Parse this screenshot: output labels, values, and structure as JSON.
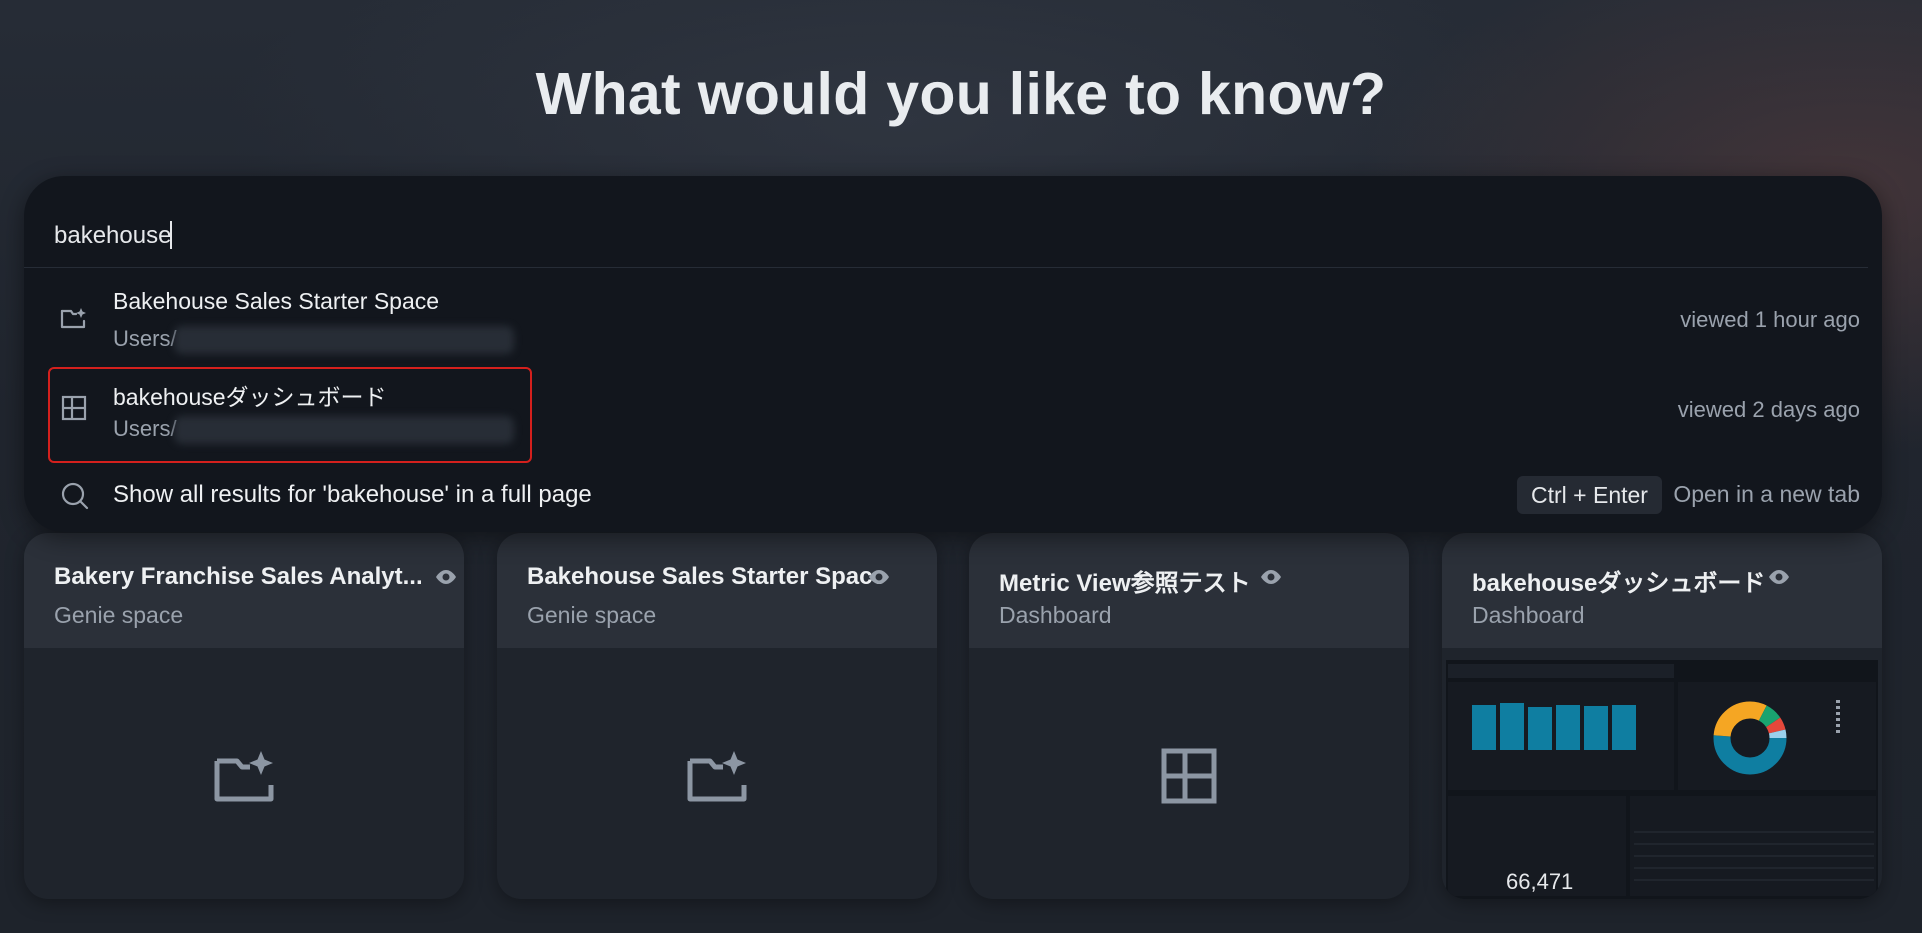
{
  "heading": "What would you like to know?",
  "search": {
    "value": "bakehouse",
    "results": [
      {
        "title": "Bakehouse Sales Starter Space",
        "path": "Users/",
        "viewed": "viewed 1 hour ago",
        "icon": "genie-space-icon"
      },
      {
        "title": "bakehouseダッシュボード",
        "path": "Users/",
        "viewed": "viewed 2 days ago",
        "icon": "dashboard-icon"
      }
    ],
    "show_all": "Show all results for 'bakehouse' in a full page",
    "shortcut": "Ctrl + Enter",
    "open_new_tab": "Open in a new tab"
  },
  "cards": [
    {
      "title": "Bakery Franchise Sales Analyt...",
      "type": "Genie space",
      "icon": "genie-space-icon"
    },
    {
      "title": "Bakehouse Sales Starter Space",
      "type": "Genie space",
      "icon": "genie-space-icon"
    },
    {
      "title": "Metric View参照テスト",
      "type": "Dashboard",
      "icon": "dashboard-icon"
    },
    {
      "title": "bakehouseダッシュボード",
      "type": "Dashboard",
      "icon": "dashboard-thumbnail",
      "thumbnail_value": "66,471"
    }
  ],
  "colors": {
    "highlight": "#d4201d",
    "accent_bar": "#0f7ea1"
  }
}
